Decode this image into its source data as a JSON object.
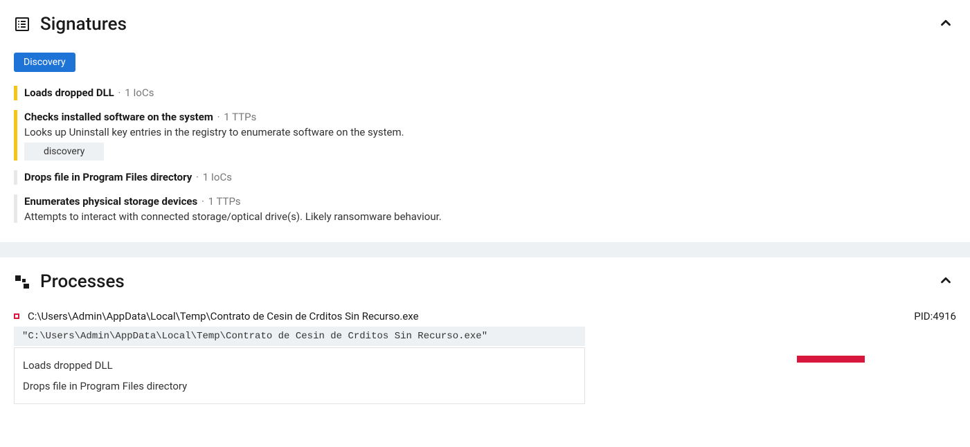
{
  "signatures": {
    "title": "Signatures",
    "filter": "Discovery",
    "items": [
      {
        "severity": "yellow",
        "title": "Loads dropped DLL",
        "meta": "1 IoCs",
        "desc": null,
        "tag": null
      },
      {
        "severity": "yellow",
        "title": "Checks installed software on the system",
        "meta": "1 TTPs",
        "desc": "Looks up Uninstall key entries in the registry to enumerate software on the system.",
        "tag": "discovery"
      },
      {
        "severity": "grey",
        "title": "Drops file in Program Files directory",
        "meta": "1 IoCs",
        "desc": null,
        "tag": null
      },
      {
        "severity": "grey",
        "title": "Enumerates physical storage devices",
        "meta": "1 TTPs",
        "desc": "Attempts to interact with connected storage/optical drive(s). Likely ransomware behaviour.",
        "tag": null
      }
    ]
  },
  "processes": {
    "title": "Processes",
    "items": [
      {
        "path": "C:\\Users\\Admin\\AppData\\Local\\Temp\\Contrato de Cesin de Crditos Sin Recurso.exe",
        "pid_label": "PID:",
        "pid": "4916",
        "cmd": "\"C:\\Users\\Admin\\AppData\\Local\\Temp\\Contrato de Cesin de Crditos Sin Recurso.exe\"",
        "signatures": [
          "Loads dropped DLL",
          "Drops file in Program Files directory"
        ]
      }
    ]
  }
}
